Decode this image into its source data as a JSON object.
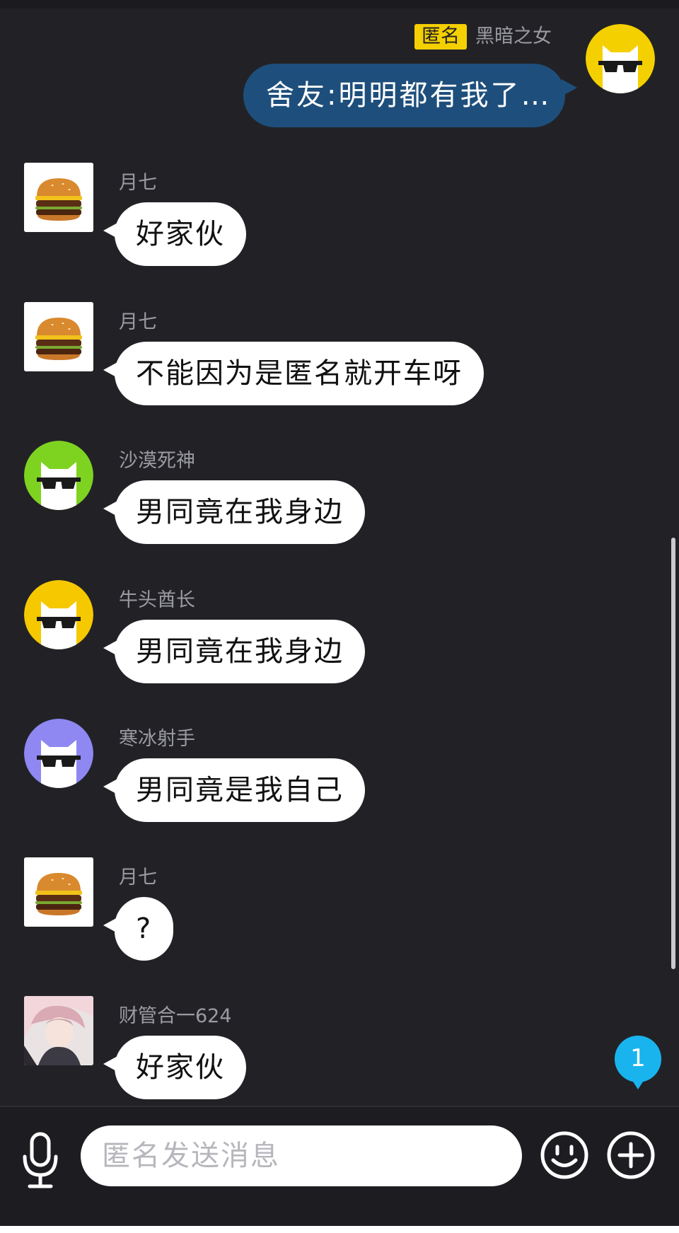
{
  "self_message": {
    "tag": "匿名",
    "name": "黑暗之女",
    "text": "舍友:明明都有我了…",
    "avatar_icon": "cool-cat-avatar",
    "avatar_color": "#f5d000"
  },
  "messages": [
    {
      "sender": "月七",
      "text": "好家伙",
      "avatar_icon": "burger-avatar"
    },
    {
      "sender": "月七",
      "text": "不能因为是匿名就开车呀",
      "avatar_icon": "burger-avatar"
    },
    {
      "sender": "沙漠死神",
      "text": "男同竟在我身边",
      "avatar_icon": "cool-cat-avatar",
      "avatar_color": "#7ed321"
    },
    {
      "sender": "牛头酋长",
      "text": "男同竟在我身边",
      "avatar_icon": "cool-cat-avatar",
      "avatar_color": "#f5c800"
    },
    {
      "sender": "寒冰射手",
      "text": "男同竟是我自己",
      "avatar_icon": "cool-cat-avatar",
      "avatar_color": "#8f88f2"
    },
    {
      "sender": "月七",
      "text": "?",
      "avatar_icon": "burger-avatar"
    },
    {
      "sender": "财管合一624",
      "text": "好家伙",
      "avatar_icon": "anime-portrait-avatar"
    }
  ],
  "unread_badge": "1",
  "composer": {
    "placeholder": "匿名发送消息",
    "mic_icon": "microphone-icon",
    "emoji_icon": "emoji-icon",
    "plus_icon": "plus-icon"
  },
  "colors": {
    "background": "#222226",
    "self_bubble": "#1e4f7c",
    "anon_tag": "#f5d000",
    "unread_badge": "#19b4ee"
  }
}
